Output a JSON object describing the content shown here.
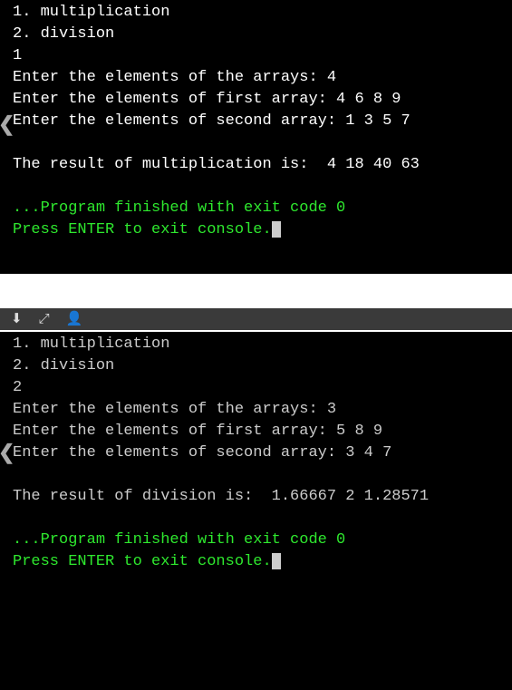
{
  "run1": {
    "menu1": "1. multiplication",
    "menu2": "2. division",
    "choice": "1",
    "prompt_count": "Enter the elements of the arrays: 4",
    "prompt_first": "Enter the elements of first array: 4 6 8 9",
    "prompt_second": "Enter the elements of second array: 1 3 5 7",
    "result": "The result of multiplication is:  4 18 40 63",
    "finished": "...Program finished with exit code 0",
    "press_enter": "Press ENTER to exit console."
  },
  "run2": {
    "menu1": "1. multiplication",
    "menu2": "2. division",
    "choice": "2",
    "prompt_count": "Enter the elements of the arrays: 3",
    "prompt_first": "Enter the elements of first array: 5 8 9",
    "prompt_second": "Enter the elements of second array: 3 4 7",
    "result": "The result of division is:  1.66667 2 1.28571",
    "finished": "...Program finished with exit code 0",
    "press_enter": "Press ENTER to exit console."
  },
  "colors": {
    "terminal_bg": "#000000",
    "text_default": "#ffffff",
    "text_success": "#2ee82e",
    "text_grey": "#cccccc",
    "cursor": "#cccccc"
  }
}
